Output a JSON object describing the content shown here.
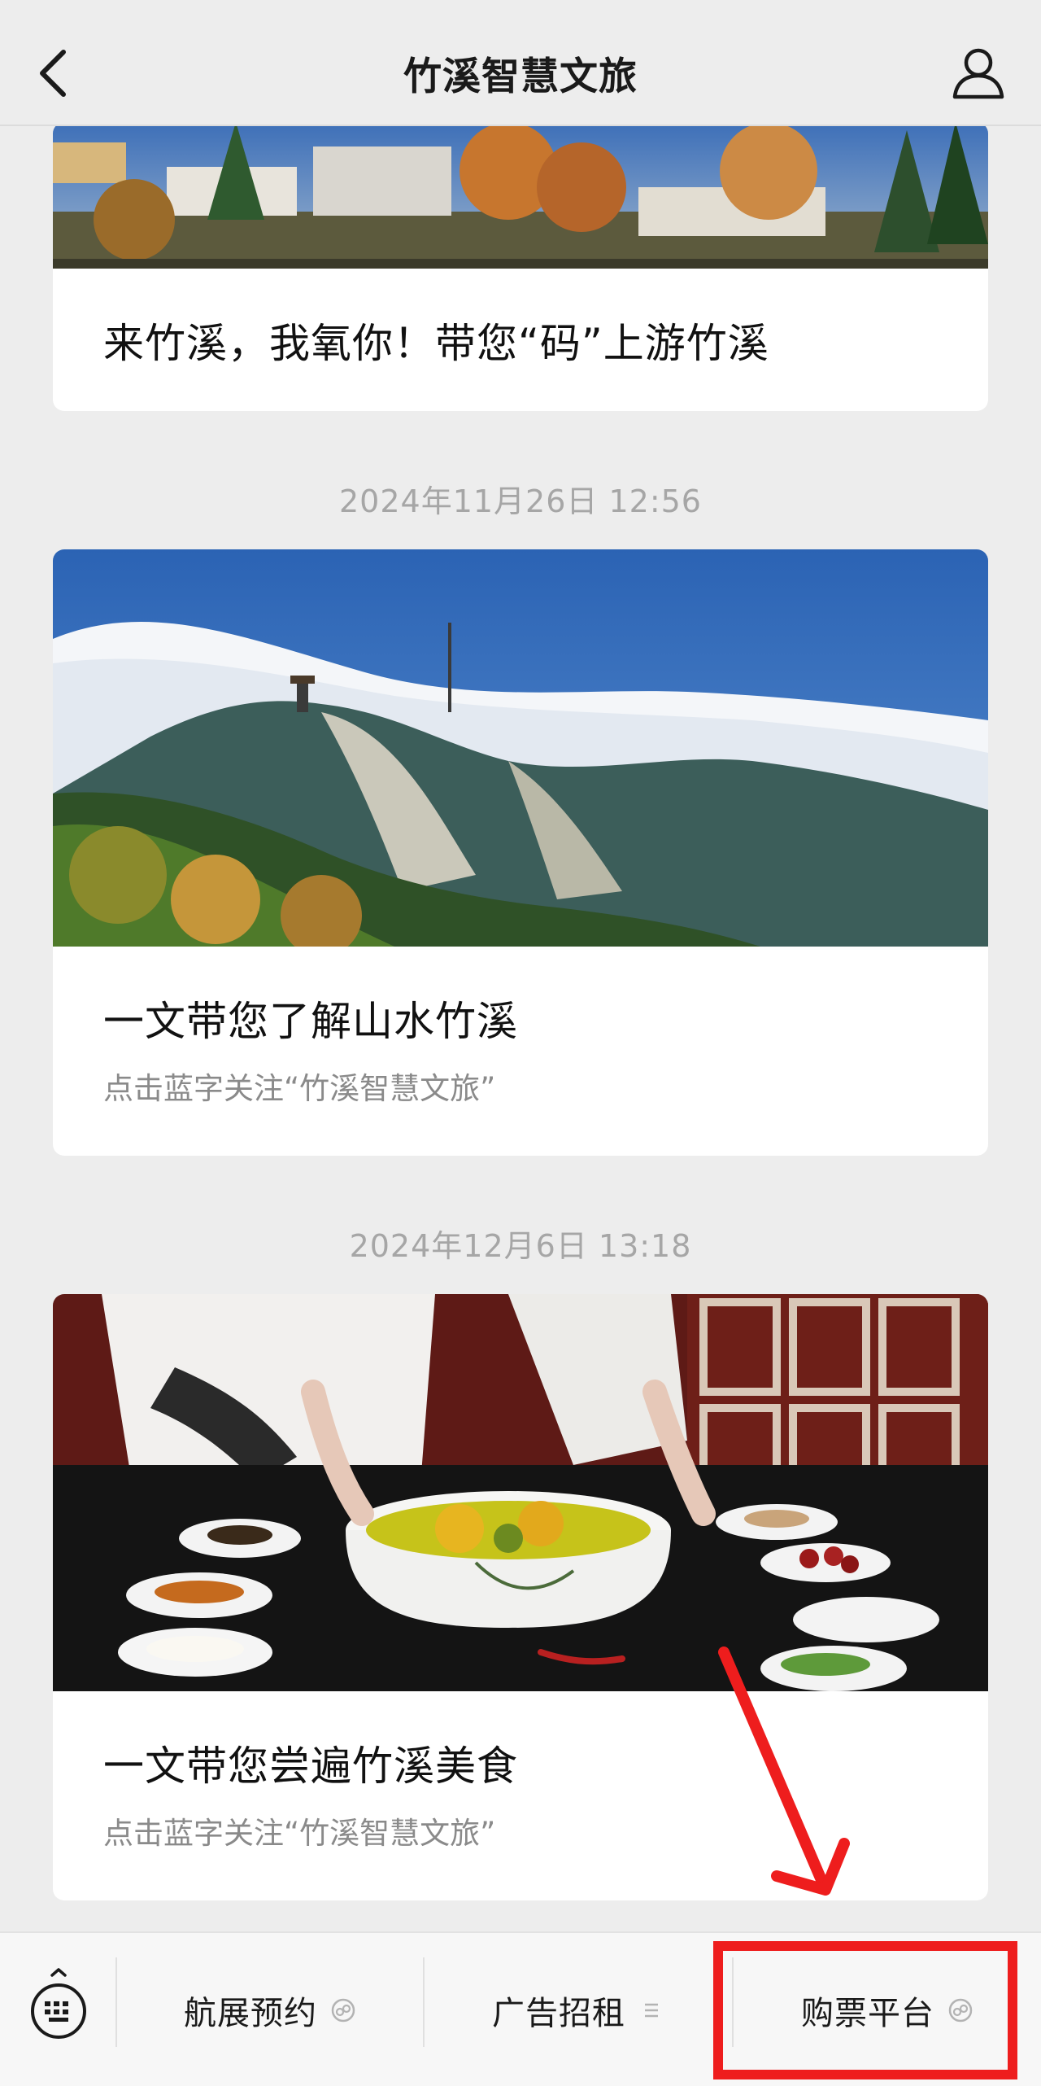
{
  "header": {
    "title": "竹溪智慧文旅"
  },
  "feed": {
    "articles": [
      {
        "title": "来竹溪，我氧你！带您“码”上游竹溪"
      },
      {
        "timestamp": "2024年11月26日 12:56",
        "title": "一文带您了解山水竹溪",
        "subtitle": "点击蓝字关注“竹溪智慧文旅”"
      },
      {
        "timestamp": "2024年12月6日 13:18",
        "title": "一文带您尝遍竹溪美食",
        "subtitle": "点击蓝字关注“竹溪智慧文旅”"
      }
    ]
  },
  "bottom_menu": {
    "items": [
      {
        "label": "航展预约",
        "icon": "mini-program-icon"
      },
      {
        "label": "广告招租",
        "icon": "submenu-lines-icon"
      },
      {
        "label": "购票平台",
        "icon": "mini-program-icon"
      }
    ]
  },
  "annotation": {
    "arrow_color": "#ee1d1d",
    "box_color": "#ee1d1d"
  }
}
